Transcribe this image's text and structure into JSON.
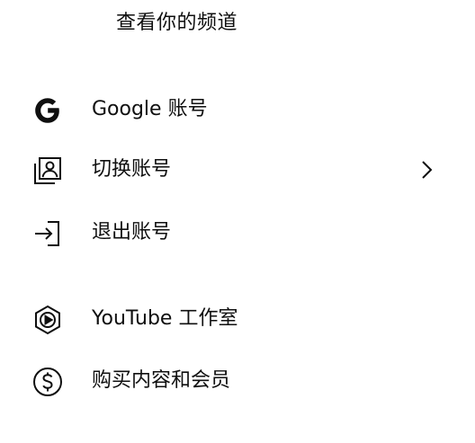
{
  "header": {
    "view_channel_label": "查看你的频道"
  },
  "menu": {
    "items": [
      {
        "label": "Google 账号",
        "icon": "google-g-icon"
      },
      {
        "label": "切换账号",
        "icon": "switch-account-icon",
        "trailing_icon": "chevron-right-icon"
      },
      {
        "label": "退出账号",
        "icon": "sign-out-icon"
      },
      {
        "label": "YouTube 工作室",
        "icon": "youtube-studio-icon"
      },
      {
        "label": "购买内容和会员",
        "icon": "dollar-circle-icon"
      }
    ]
  }
}
